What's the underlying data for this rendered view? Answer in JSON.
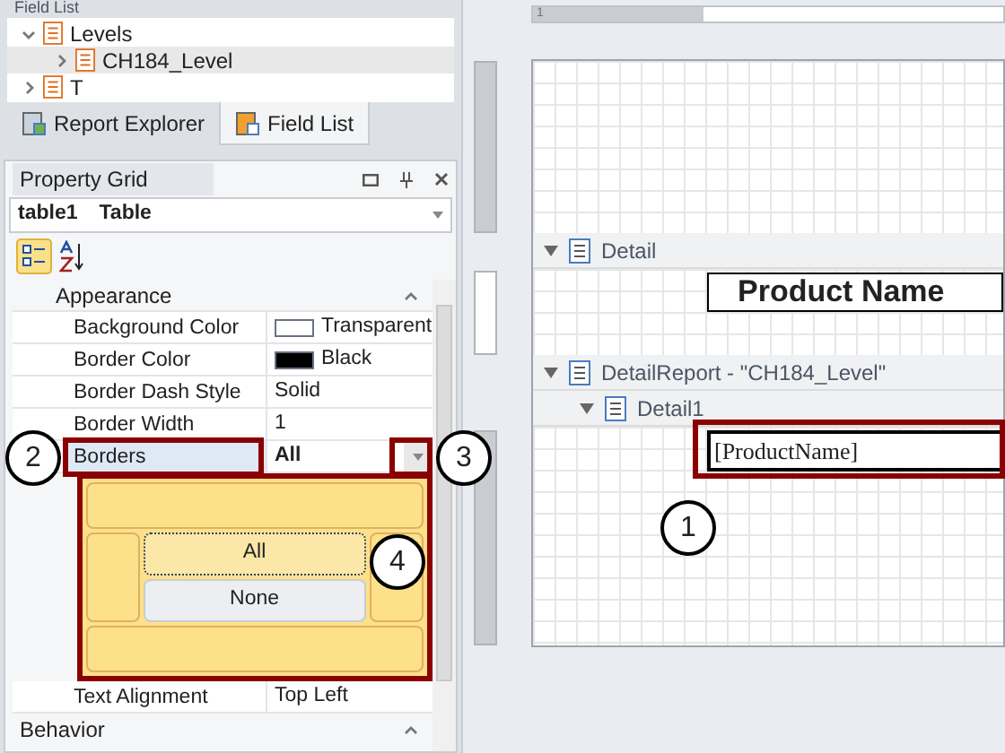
{
  "field_list": {
    "title": "Field List",
    "tree": [
      {
        "label": "Levels",
        "expanded": true,
        "selected": false,
        "children": [
          {
            "label": "CH184_Level",
            "expanded": false,
            "selected": true
          }
        ]
      },
      {
        "label": "T",
        "expanded": false,
        "selected": false
      }
    ],
    "tabs": [
      {
        "label": "Report Explorer",
        "selected": false
      },
      {
        "label": "Field List",
        "selected": true
      }
    ]
  },
  "property_grid": {
    "title": "Property Grid",
    "object_name": "table1",
    "object_type": "Table",
    "categorized": true,
    "categories": [
      {
        "label": "Appearance",
        "expanded": true,
        "rows": [
          {
            "name": "Background Color",
            "value": "Transparent",
            "color": "#ffffff",
            "selected": false
          },
          {
            "name": "Border Color",
            "value": "Black",
            "color": "#000000",
            "selected": false
          },
          {
            "name": "Border Dash Style",
            "value": "Solid",
            "selected": false
          },
          {
            "name": "Border Width",
            "value": "1",
            "selected": false
          },
          {
            "name": "Borders",
            "value": "All",
            "selected": true
          }
        ],
        "popup": {
          "buttons": [
            {
              "label": "All",
              "selected": true
            },
            {
              "label": "None",
              "selected": false
            }
          ]
        },
        "after_rows": [
          {
            "name": "Text Alignment",
            "value": "Top Left",
            "selected": false
          }
        ]
      },
      {
        "label": "Behavior",
        "expanded": true
      }
    ]
  },
  "designer": {
    "bands": [
      {
        "label": "Detail",
        "kind": "band"
      },
      {
        "label": "DetailReport - \"CH184_Level\"",
        "kind": "report"
      },
      {
        "label": "Detail1",
        "kind": "sub"
      }
    ],
    "header_cell": "Product Name",
    "field_cell": "[ProductName]",
    "ruler_label": "1"
  },
  "callouts": [
    "1",
    "2",
    "3",
    "4"
  ]
}
